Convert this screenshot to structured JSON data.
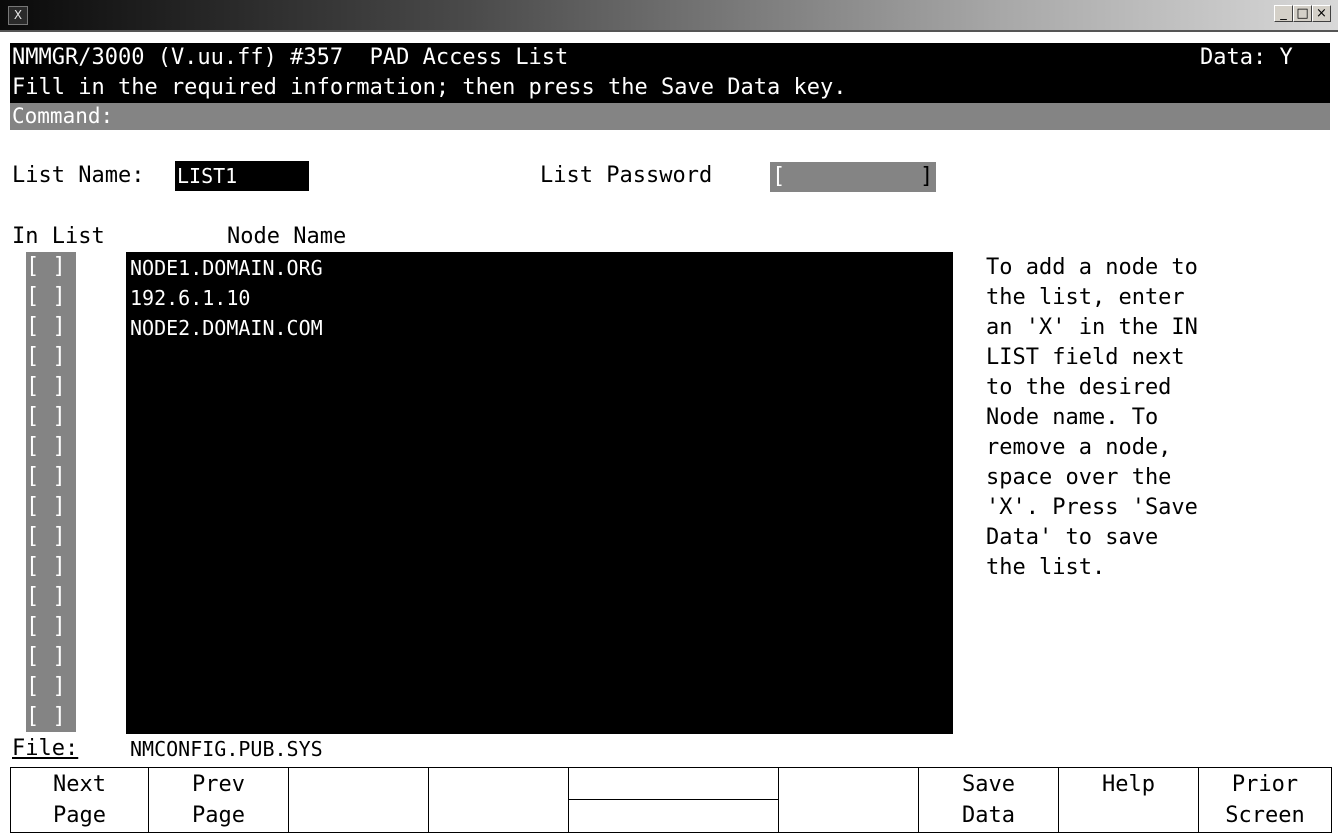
{
  "window": {
    "logo": "X",
    "controls": {
      "minimize": "_",
      "maximize": "□",
      "close": "×"
    }
  },
  "header": {
    "title": "NMMGR/3000 (V.uu.ff) #357  PAD Access List",
    "data_flag": "Data: Y",
    "instruction": "Fill in the required information; then press the Save Data key.",
    "command_label": "Command:"
  },
  "form": {
    "list_name_label": "List Name:",
    "list_name_value": "LIST1",
    "list_password_label": "List Password",
    "password_open": "[",
    "password_close": "]"
  },
  "nodes": {
    "in_list_header": "In List",
    "node_name_header": "Node Name",
    "checkbox_text": "[ ]",
    "entries": [
      "NODE1.DOMAIN.ORG",
      "192.6.1.10",
      "NODE2.DOMAIN.COM"
    ]
  },
  "help": {
    "text": "To add a node to\nthe list, enter\nan 'X' in the IN\nLIST field next\nto the desired\nNode name. To\nremove a node,\nspace over the\n'X'. Press 'Save\nData' to save\nthe list."
  },
  "file": {
    "label": "File:",
    "value": "NMCONFIG.PUB.SYS"
  },
  "function_keys": [
    {
      "label": "Next\nPage"
    },
    {
      "label": "Prev\nPage"
    },
    {
      "label": ""
    },
    {
      "label": ""
    },
    {
      "label": ""
    },
    {
      "label": ""
    },
    {
      "label": "Save\nData"
    },
    {
      "label": "Help"
    },
    {
      "label": "Prior\nScreen"
    }
  ],
  "colors": {
    "field_gray": "#848484",
    "background": "#ffffff",
    "panel_black": "#000000"
  }
}
